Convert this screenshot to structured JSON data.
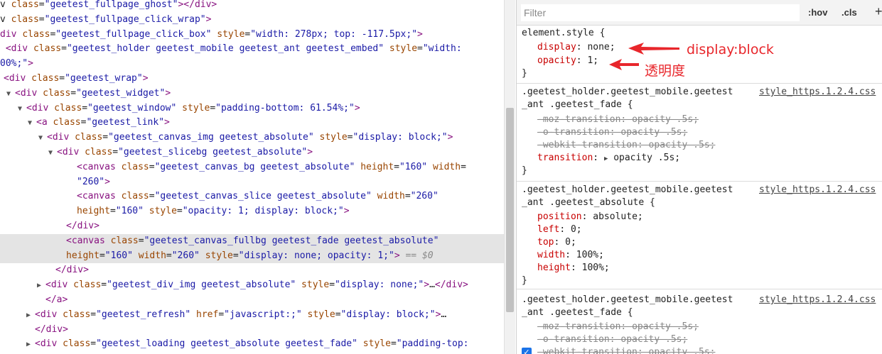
{
  "elements": {
    "lines": [
      {
        "ind": 0,
        "tri": "",
        "segs": [
          [
            "txt",
            "v "
          ],
          [
            "attr",
            "class"
          ],
          [
            "txt",
            "="
          ],
          [
            "val",
            "\"geetest_fullpage_ghost\""
          ],
          [
            "tag",
            "></div>"
          ]
        ]
      },
      {
        "ind": 0,
        "tri": "",
        "segs": [
          [
            "txt",
            "v "
          ],
          [
            "attr",
            "class"
          ],
          [
            "txt",
            "="
          ],
          [
            "val",
            "\"geetest_fullpage_click_wrap\""
          ],
          [
            "tag",
            ">"
          ]
        ]
      },
      {
        "ind": 0,
        "tri": "",
        "segs": [
          [
            "tag",
            "div "
          ],
          [
            "attr",
            "class"
          ],
          [
            "txt",
            "="
          ],
          [
            "val",
            "\"geetest_fullpage_click_box\""
          ],
          [
            "txt",
            " "
          ],
          [
            "attr",
            "style"
          ],
          [
            "txt",
            "="
          ],
          [
            "val",
            "\"width: 278px; top: -117.5px;\""
          ],
          [
            "tag",
            ">"
          ]
        ]
      },
      {
        "ind": 0,
        "tri": "",
        "segs": [
          [
            "txt",
            " "
          ],
          [
            "tag",
            "<div "
          ],
          [
            "attr",
            "class"
          ],
          [
            "txt",
            "="
          ],
          [
            "val",
            "\"geetest_holder geetest_mobile geetest_ant geetest_embed\""
          ],
          [
            "txt",
            " "
          ],
          [
            "attr",
            "style"
          ],
          [
            "txt",
            "="
          ],
          [
            "val",
            "\"width:"
          ]
        ]
      },
      {
        "ind": 0,
        "tri": "",
        "segs": [
          [
            "val",
            "00%;\""
          ],
          [
            "tag",
            ">"
          ]
        ]
      },
      {
        "ind": 5,
        "tri": "▼",
        "segs": [
          [
            "tag",
            "<div "
          ],
          [
            "attr",
            "class"
          ],
          [
            "txt",
            "="
          ],
          [
            "val",
            "\"geetest_wrap\""
          ],
          [
            "tag",
            ">"
          ]
        ]
      },
      {
        "ind": 21,
        "tri": "▼",
        "segs": [
          [
            "tag",
            "<div "
          ],
          [
            "attr",
            "class"
          ],
          [
            "txt",
            "="
          ],
          [
            "val",
            "\"geetest_widget\""
          ],
          [
            "tag",
            ">"
          ]
        ]
      },
      {
        "ind": 37,
        "tri": "▼",
        "segs": [
          [
            "tag",
            "<div "
          ],
          [
            "attr",
            "class"
          ],
          [
            "txt",
            "="
          ],
          [
            "val",
            "\"geetest_window\""
          ],
          [
            "txt",
            " "
          ],
          [
            "attr",
            "style"
          ],
          [
            "txt",
            "="
          ],
          [
            "val",
            "\"padding-bottom: 61.54%;\""
          ],
          [
            "tag",
            ">"
          ]
        ]
      },
      {
        "ind": 51,
        "tri": "▼",
        "segs": [
          [
            "tag",
            "<a "
          ],
          [
            "attr",
            "class"
          ],
          [
            "txt",
            "="
          ],
          [
            "val",
            "\"geetest_link\""
          ],
          [
            "tag",
            ">"
          ]
        ]
      },
      {
        "ind": 66,
        "tri": "▼",
        "segs": [
          [
            "tag",
            "<div "
          ],
          [
            "attr",
            "class"
          ],
          [
            "txt",
            "="
          ],
          [
            "val",
            "\"geetest_canvas_img geetest_absolute\""
          ],
          [
            "txt",
            " "
          ],
          [
            "attr",
            "style"
          ],
          [
            "txt",
            "="
          ],
          [
            "val",
            "\"display: block;\""
          ],
          [
            "tag",
            ">"
          ]
        ]
      },
      {
        "ind": 80,
        "tri": "▼",
        "segs": [
          [
            "tag",
            "<div "
          ],
          [
            "attr",
            "class"
          ],
          [
            "txt",
            "="
          ],
          [
            "val",
            "\"geetest_slicebg geetest_absolute\""
          ],
          [
            "tag",
            ">"
          ]
        ]
      },
      {
        "ind": 108,
        "tri": "",
        "segs": [
          [
            "tag",
            "<canvas "
          ],
          [
            "attr",
            "class"
          ],
          [
            "txt",
            "="
          ],
          [
            "val",
            "\"geetest_canvas_bg geetest_absolute\""
          ],
          [
            "txt",
            " "
          ],
          [
            "attr",
            "height"
          ],
          [
            "txt",
            "="
          ],
          [
            "val",
            "\"160\""
          ],
          [
            "txt",
            " "
          ],
          [
            "attr",
            "width"
          ],
          [
            "txt",
            "="
          ]
        ]
      },
      {
        "ind": 108,
        "tri": "",
        "segs": [
          [
            "val",
            "\"260\""
          ],
          [
            "tag",
            ">"
          ]
        ]
      },
      {
        "ind": 108,
        "tri": "",
        "segs": [
          [
            "tag",
            "<canvas "
          ],
          [
            "attr",
            "class"
          ],
          [
            "txt",
            "="
          ],
          [
            "val",
            "\"geetest_canvas_slice geetest_absolute\""
          ],
          [
            "txt",
            " "
          ],
          [
            "attr",
            "width"
          ],
          [
            "txt",
            "="
          ],
          [
            "val",
            "\"260\""
          ]
        ]
      },
      {
        "ind": 108,
        "tri": "",
        "segs": [
          [
            "attr",
            "height"
          ],
          [
            "txt",
            "="
          ],
          [
            "val",
            "\"160\""
          ],
          [
            "txt",
            " "
          ],
          [
            "attr",
            "style"
          ],
          [
            "txt",
            "="
          ],
          [
            "val",
            "\"opacity: 1; display: block;\""
          ],
          [
            "tag",
            ">"
          ]
        ]
      },
      {
        "ind": 93,
        "tri": "",
        "segs": [
          [
            "tag",
            "</div>"
          ]
        ]
      },
      {
        "ind": 93,
        "tri": "",
        "hl": true,
        "segs": [
          [
            "tag",
            "<canvas "
          ],
          [
            "attr",
            "class"
          ],
          [
            "txt",
            "="
          ],
          [
            "val",
            "\"geetest_canvas_fullbg geetest_fade geetest_absolute\""
          ]
        ]
      },
      {
        "ind": 93,
        "tri": "",
        "hl": true,
        "segs": [
          [
            "attr",
            "height"
          ],
          [
            "txt",
            "="
          ],
          [
            "val",
            "\"160\""
          ],
          [
            "txt",
            " "
          ],
          [
            "attr",
            "width"
          ],
          [
            "txt",
            "="
          ],
          [
            "val",
            "\"260\""
          ],
          [
            "txt",
            " "
          ],
          [
            "attr",
            "style"
          ],
          [
            "txt",
            "="
          ],
          [
            "val",
            "\"display: none; opacity: 1;\""
          ],
          [
            "tag",
            ">"
          ],
          [
            "dim",
            " == $0"
          ]
        ]
      },
      {
        "ind": 78,
        "tri": "",
        "segs": [
          [
            "tag",
            "</div>"
          ]
        ]
      },
      {
        "ind": 64,
        "tri": "▶",
        "segs": [
          [
            "tag",
            "<div "
          ],
          [
            "attr",
            "class"
          ],
          [
            "txt",
            "="
          ],
          [
            "val",
            "\"geetest_div_img geetest_absolute\""
          ],
          [
            "txt",
            " "
          ],
          [
            "attr",
            "style"
          ],
          [
            "txt",
            "="
          ],
          [
            "val",
            "\"display: none;\""
          ],
          [
            "tag",
            ">"
          ],
          [
            "txt",
            "…"
          ],
          [
            "tag",
            "</div>"
          ]
        ]
      },
      {
        "ind": 64,
        "tri": "",
        "segs": [
          [
            "tag",
            "</a>"
          ]
        ]
      },
      {
        "ind": 49,
        "tri": "▶",
        "segs": [
          [
            "tag",
            "<div "
          ],
          [
            "attr",
            "class"
          ],
          [
            "txt",
            "="
          ],
          [
            "val",
            "\"geetest_refresh\""
          ],
          [
            "txt",
            " "
          ],
          [
            "attr",
            "href"
          ],
          [
            "txt",
            "="
          ],
          [
            "val",
            "\"javascript:;\""
          ],
          [
            "txt",
            " "
          ],
          [
            "attr",
            "style"
          ],
          [
            "txt",
            "="
          ],
          [
            "val",
            "\"display: block;\""
          ],
          [
            "tag",
            ">"
          ],
          [
            "txt",
            "…"
          ]
        ]
      },
      {
        "ind": 49,
        "tri": "",
        "segs": [
          [
            "tag",
            "</div>"
          ]
        ]
      },
      {
        "ind": 49,
        "tri": "▶",
        "segs": [
          [
            "tag",
            "<div "
          ],
          [
            "attr",
            "class"
          ],
          [
            "txt",
            "="
          ],
          [
            "val",
            "\"geetest_loading geetest_absolute geetest_fade\""
          ],
          [
            "txt",
            " "
          ],
          [
            "attr",
            "style"
          ],
          [
            "txt",
            "="
          ],
          [
            "val",
            "\"padding-top:"
          ]
        ]
      }
    ]
  },
  "styles": {
    "filter_placeholder": "Filter",
    "hov_label": ":hov",
    "cls_label": ".cls",
    "plus_label": "+",
    "element_style": {
      "selector": "element.style {",
      "props": [
        {
          "name": "display",
          "value": "none;"
        },
        {
          "name": "opacity",
          "value": "1;"
        }
      ],
      "close": "}"
    },
    "rules": [
      {
        "selector_line1": ".geetest_holder.geetest_mobile.geetest",
        "selector_line2": "_ant .geetest_fade {",
        "source": "style_https.1.2.4.css",
        "props": [
          {
            "name": "-moz-transition",
            "value": "opacity .5s;",
            "struck": true
          },
          {
            "name": "-o-transition",
            "value": "opacity .5s;",
            "struck": true
          },
          {
            "name": "-webkit-transition",
            "value": "opacity .5s;",
            "struck": true
          },
          {
            "name": "transition",
            "value": "opacity .5s;",
            "struck": false,
            "expand": true
          }
        ],
        "close": "}"
      },
      {
        "selector_line1": ".geetest_holder.geetest_mobile.geetest",
        "selector_line2": "_ant .geetest_absolute {",
        "source": "style_https.1.2.4.css",
        "props": [
          {
            "name": "position",
            "value": "absolute;",
            "struck": false
          },
          {
            "name": "left",
            "value": "0;",
            "struck": false
          },
          {
            "name": "top",
            "value": "0;",
            "struck": false
          },
          {
            "name": "width",
            "value": "100%;",
            "struck": false
          },
          {
            "name": "height",
            "value": "100%;",
            "struck": false
          }
        ],
        "close": "}"
      },
      {
        "selector_line1": ".geetest_holder.geetest_mobile.geetest",
        "selector_line2": "_ant .geetest_fade {",
        "source": "style_https.1.2.4.css",
        "props": [
          {
            "name": "-moz-transition",
            "value": "opacity .5s;",
            "struck": true
          },
          {
            "name": "-o-transition",
            "value": "opacity .5s;",
            "struck": true
          },
          {
            "name": "-webkit-transition",
            "value": "opacity .5s;",
            "struck": true,
            "checked": true
          }
        ],
        "close": ""
      }
    ]
  },
  "annotations": {
    "display_note": "display:block",
    "opacity_note": "透明度",
    "color": "#e8262b"
  }
}
